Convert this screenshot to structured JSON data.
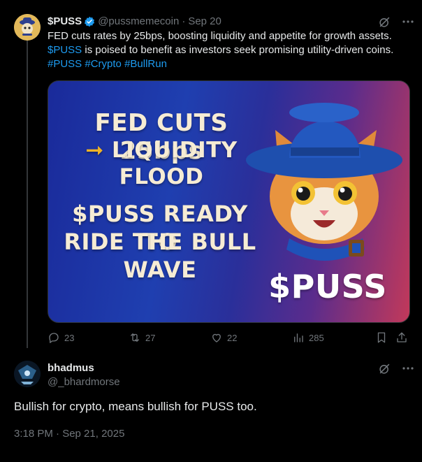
{
  "colors": {
    "background": "#000000",
    "text_primary": "#e7e9ea",
    "text_secondary": "#71767b",
    "link": "#1d9bf0",
    "verified_badge": "#1d9bf0",
    "image_text": "#f6ecd4",
    "image_arrow": "#f0b326"
  },
  "tweet": {
    "author_name": "$PUSS",
    "verified_icon": "verified-badge-icon",
    "author_handle": "@pussmemecoin",
    "separator": "·",
    "date": "Sep 20",
    "text_line1": "FED cuts rates by 25bps, boosting liquidity and appetite for growth assets.",
    "text_line2_link": "$PUSS",
    "text_line2_rest": " is poised to benefit as investors seek promising utility-driven coins.",
    "hashtag1": "#PUSS",
    "hashtag2": "#Crypto",
    "hashtag3": "#BullRun",
    "image": {
      "line1": "FED CUTS 25bps",
      "line2_arrow": "➞",
      "line2": "LIQUIDITY",
      "line3": "FLOOD",
      "line4": "$PUSS READY TO",
      "line5": "RIDE THE BULL",
      "line6": "WAVE",
      "brand": "$PUSS"
    },
    "actions": {
      "replies": "23",
      "reposts": "27",
      "likes": "22",
      "views": "285"
    }
  },
  "reply": {
    "author_name": "bhadmus",
    "author_handle": "@_bhardmorse",
    "text": "Bullish for crypto, means bullish for PUSS too.",
    "timestamp": "3:18 PM · Sep 21, 2025"
  },
  "icons": {
    "grok": "grok-icon",
    "more": "more-icon",
    "reply": "reply-icon",
    "repost": "repost-icon",
    "like": "heart-icon",
    "views": "views-icon",
    "bookmark": "bookmark-icon",
    "share": "share-icon"
  }
}
